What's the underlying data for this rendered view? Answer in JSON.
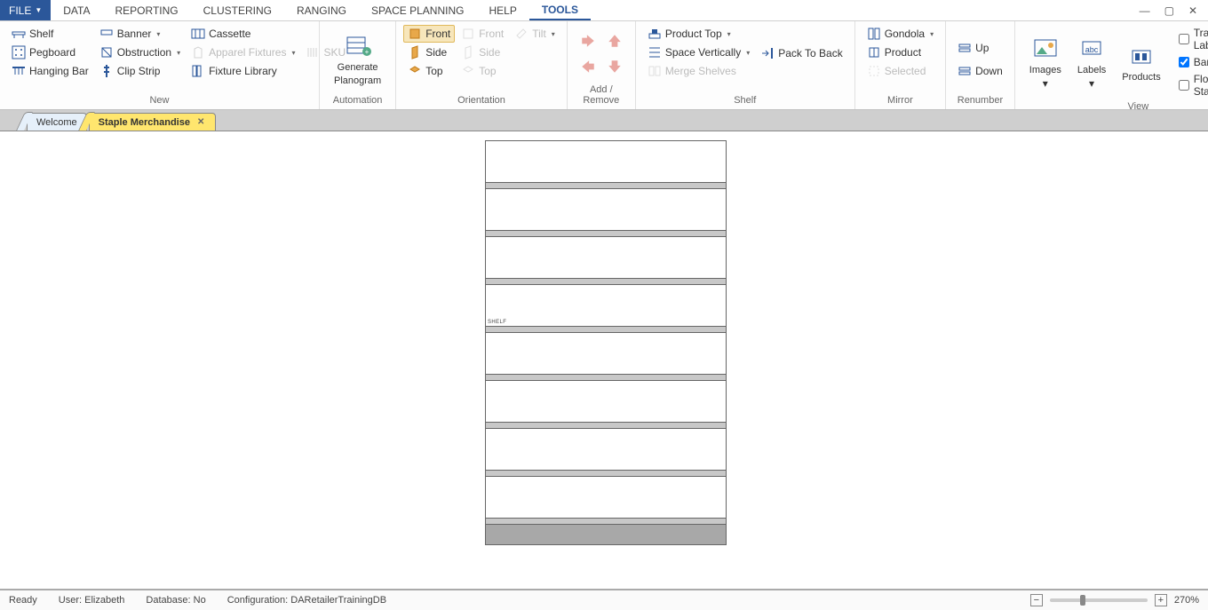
{
  "menu": {
    "file": "FILE",
    "items": [
      "DATA",
      "REPORTING",
      "CLUSTERING",
      "RANGING",
      "SPACE PLANNING",
      "HELP",
      "TOOLS"
    ],
    "active": "TOOLS"
  },
  "ribbon": {
    "new": {
      "label": "New",
      "shelf": "Shelf",
      "banner": "Banner",
      "cassette": "Cassette",
      "pegboard": "Pegboard",
      "obstruction": "Obstruction",
      "apparel": "Apparel Fixtures",
      "sku": "SKU",
      "hanging": "Hanging Bar",
      "clip": "Clip Strip",
      "library": "Fixture Library"
    },
    "automation": {
      "label": "Automation",
      "generate1": "Generate",
      "generate2": "Planogram"
    },
    "orientation": {
      "label": "Orientation",
      "front": "Front",
      "side": "Side",
      "top": "Top",
      "tilt": "Tilt"
    },
    "addremove": {
      "label": "Add / Remove"
    },
    "shelf": {
      "label": "Shelf",
      "prodtop": "Product Top",
      "spacev": "Space Vertically",
      "pack": "Pack To Back",
      "merge": "Merge Shelves"
    },
    "mirror": {
      "label": "Mirror",
      "gondola": "Gondola",
      "product": "Product",
      "selected": "Selected"
    },
    "renumber": {
      "label": "Renumber",
      "up": "Up",
      "down": "Down"
    },
    "view": {
      "label": "View",
      "images": "Images",
      "labels": "Labels",
      "products": "Products",
      "transparent": "Transparent Lab",
      "banners": "Banners",
      "floating": "Floating Status"
    }
  },
  "tabs": {
    "welcome": "Welcome",
    "doc": "Staple Merchandise"
  },
  "planogram": {
    "shelf_label": "SHELF",
    "shelf_count": 8
  },
  "status": {
    "ready": "Ready",
    "user_label": "User:",
    "user": "Elizabeth",
    "db_label": "Database:",
    "db": "No",
    "cfg_label": "Configuration:",
    "cfg": "DARetailerTrainingDB",
    "zoom": "270%"
  }
}
